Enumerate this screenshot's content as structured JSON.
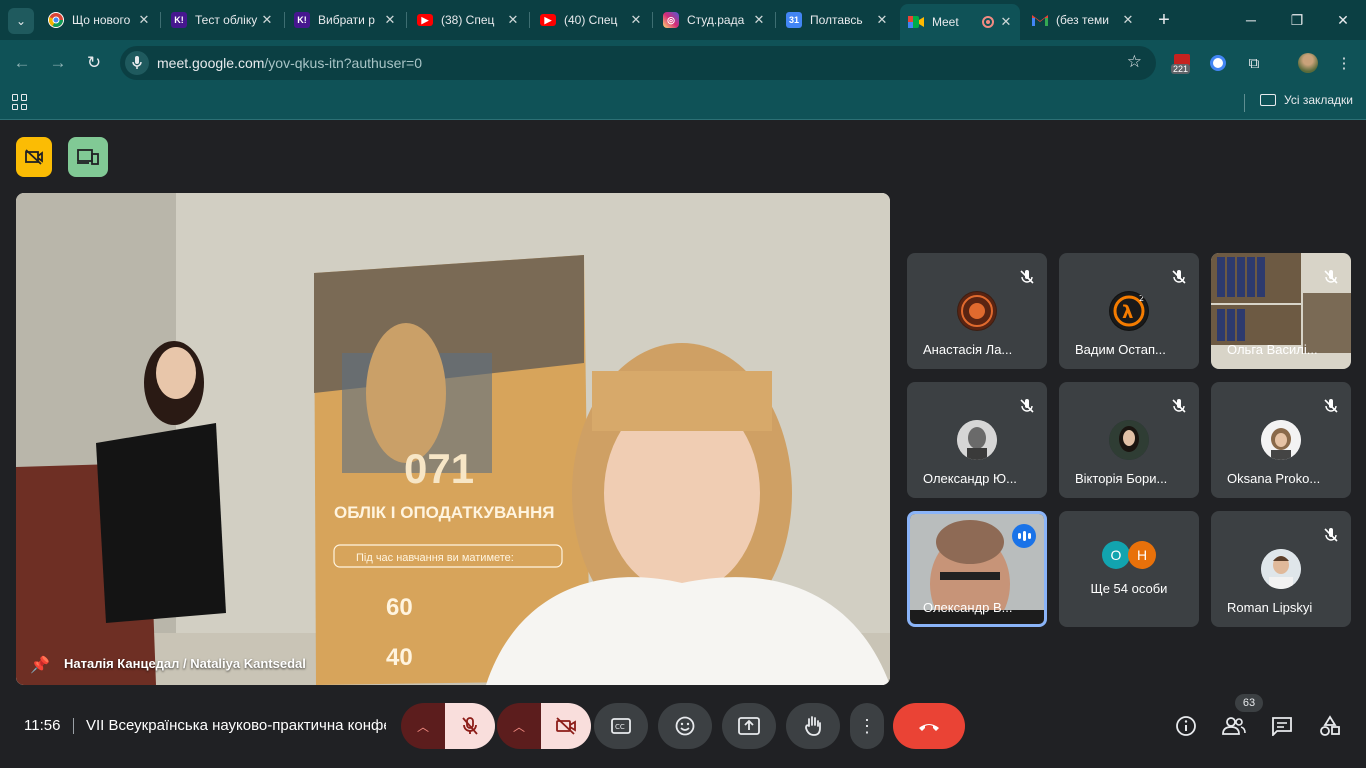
{
  "browser": {
    "tabs": [
      {
        "title": "Що нового",
        "favicon": "chrome-icon"
      },
      {
        "title": "Тест обліку",
        "favicon": "kahoot-icon"
      },
      {
        "title": "Вибрати р",
        "favicon": "kahoot-icon"
      },
      {
        "title": "(38) Спец",
        "favicon": "youtube-icon"
      },
      {
        "title": "(40) Спец",
        "favicon": "youtube-icon"
      },
      {
        "title": "Студ.рада",
        "favicon": "instagram-icon"
      },
      {
        "title": "Полтавсь",
        "favicon": "calendar-icon"
      },
      {
        "title": "Meet",
        "favicon": "meet-icon"
      },
      {
        "title": "(без теми",
        "favicon": "gmail-icon"
      }
    ],
    "url_host": "meet.google.com",
    "url_path": "/yov-qkus-itn?authuser=0",
    "extension_badge": "221",
    "calendar_day": "31",
    "bookmarks_all": "Усі закладки"
  },
  "meet": {
    "main_speaker": "Наталія Канцедал / Nataliya Kantsedal",
    "participants": [
      {
        "name": "Анастасія Ла...",
        "avatar": "rooster-icon",
        "muted": true
      },
      {
        "name": "Вадим Остап...",
        "avatar": "half-life-icon",
        "muted": true
      },
      {
        "name": "Ольга Василі...",
        "avatar": "office-video",
        "muted": true
      },
      {
        "name": "Олександр Ю...",
        "avatar": "portrait-photo",
        "muted": true
      },
      {
        "name": "Вікторія Бори...",
        "avatar": "portrait-photo",
        "muted": true
      },
      {
        "name": "Oksana Proko...",
        "avatar": "portrait-photo",
        "muted": true
      },
      {
        "name": "Олександр В...",
        "avatar": "man-video",
        "muted": false
      },
      {
        "name": "Ще 54 особи",
        "avatar": "others-initials",
        "initials": [
          "О",
          "Н"
        ]
      },
      {
        "name": "Roman Lipskyi",
        "avatar": "portrait-photo",
        "muted": true
      }
    ],
    "clock": "11:56",
    "meeting_title": "VII Всеукраїнська науково-практична конференція",
    "people_count": "63",
    "colors": {
      "accent_yellow": "#fbbc04",
      "accent_green": "#81c995",
      "hangup": "#ea4335",
      "speaking": "#8ab4f8"
    }
  }
}
